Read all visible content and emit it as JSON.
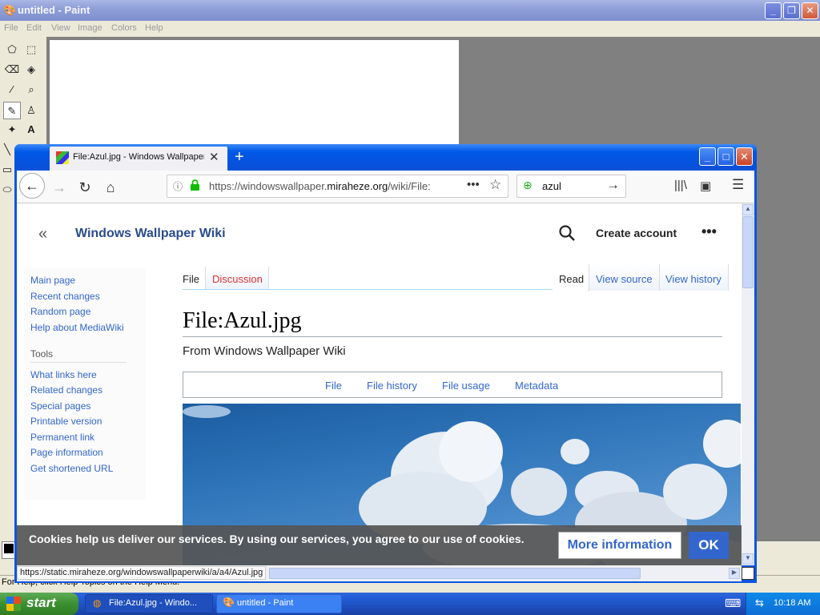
{
  "paint": {
    "title": "untitled - Paint",
    "menu": [
      "File",
      "Edit",
      "View",
      "Image",
      "Colors",
      "Help"
    ],
    "status": "For Help, click Help Topics on the Help Menu.",
    "window_buttons": {
      "minimize": "_",
      "maximize": "❐",
      "close": "✕"
    }
  },
  "firefox": {
    "tab_title": "File:Azul.jpg - Windows Wallpaper",
    "tab_close": "✕",
    "new_tab": "+",
    "window_buttons": {
      "minimize": "_",
      "maximize": "□",
      "close": "✕"
    },
    "url_prefix": "https://windowswallpaper.",
    "url_domain": "miraheze.org",
    "url_suffix": "/wiki/File:",
    "url_more": "•••",
    "url_star": "☆",
    "search_text": "azul",
    "search_go": "→",
    "back": "←",
    "forward": "→",
    "reload": "↻",
    "home": "⌂",
    "library": "|||\\",
    "sidebar_toggle": "▣",
    "menu": "☰",
    "status_url": "https://static.miraheze.org/windowswallpaperwiki/a/a4/Azul.jpg"
  },
  "wiki": {
    "collapse": "«",
    "name": "Windows Wallpaper Wiki",
    "search_glyph": "⚲",
    "create_account": "Create account",
    "more": "•••",
    "nav": [
      "Main page",
      "Recent changes",
      "Random page",
      "Help about MediaWiki"
    ],
    "tools_heading": "Tools",
    "tools": [
      "What links here",
      "Related changes",
      "Special pages",
      "Printable version",
      "Permanent link",
      "Page information",
      "Get shortened URL"
    ],
    "tabs": {
      "file": "File",
      "discussion": "Discussion",
      "read": "Read",
      "view_source": "View source",
      "view_history": "View history"
    },
    "page_title": "File:Azul.jpg",
    "from": "From Windows Wallpaper Wiki",
    "toc": [
      "File",
      "File history",
      "File usage",
      "Metadata"
    ],
    "cookie_text": "Cookies help us deliver our services. By using our services, you agree to our use of cookies.",
    "more_info": "More information",
    "ok": "OK"
  },
  "taskbar": {
    "start": "start",
    "tasks": [
      "File:Azul.jpg - Windo...",
      "untitled - Paint"
    ],
    "clock": "10:18 AM"
  },
  "colors": {
    "xp_blue": "#0058e6",
    "start_green": "#3c8f31",
    "wiki_link": "#3366cc",
    "wiki_red_link": "#dd3333",
    "cookie_bg": "#555555"
  }
}
